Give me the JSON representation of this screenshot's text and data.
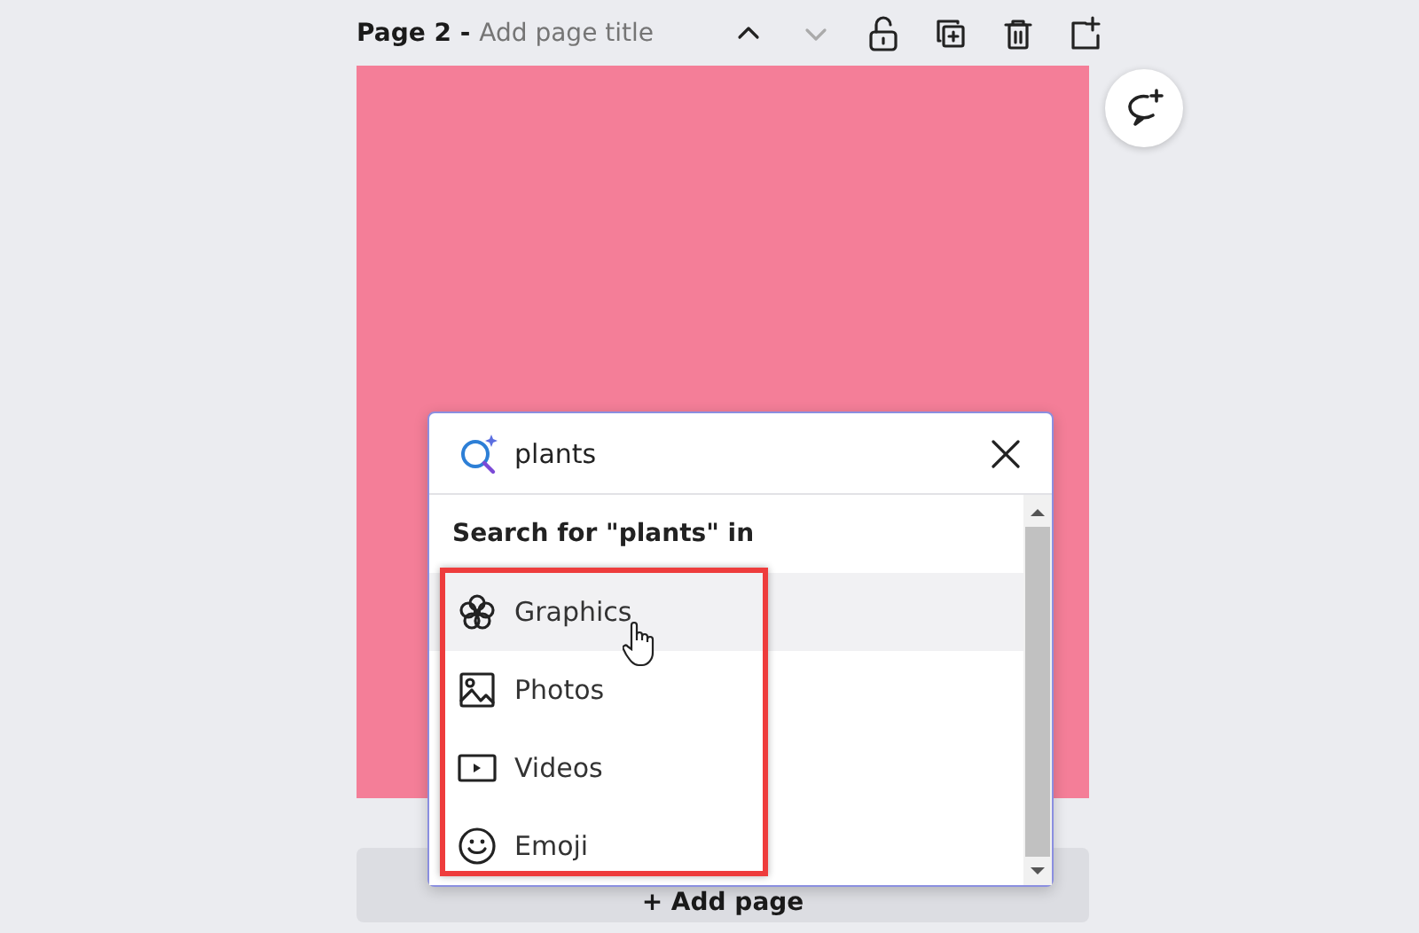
{
  "page_header": {
    "page_label": "Page 2 -",
    "title_placeholder": "Add page title"
  },
  "add_page_button": "+ Add page",
  "search_popup": {
    "query": "plants",
    "heading": "Search for \"plants\" in",
    "items": [
      {
        "label": "Graphics",
        "kind": "graphics",
        "selected": true
      },
      {
        "label": "Photos",
        "kind": "photos",
        "selected": false
      },
      {
        "label": "Videos",
        "kind": "videos",
        "selected": false
      },
      {
        "label": "Emoji",
        "kind": "emoji",
        "selected": false
      }
    ]
  }
}
